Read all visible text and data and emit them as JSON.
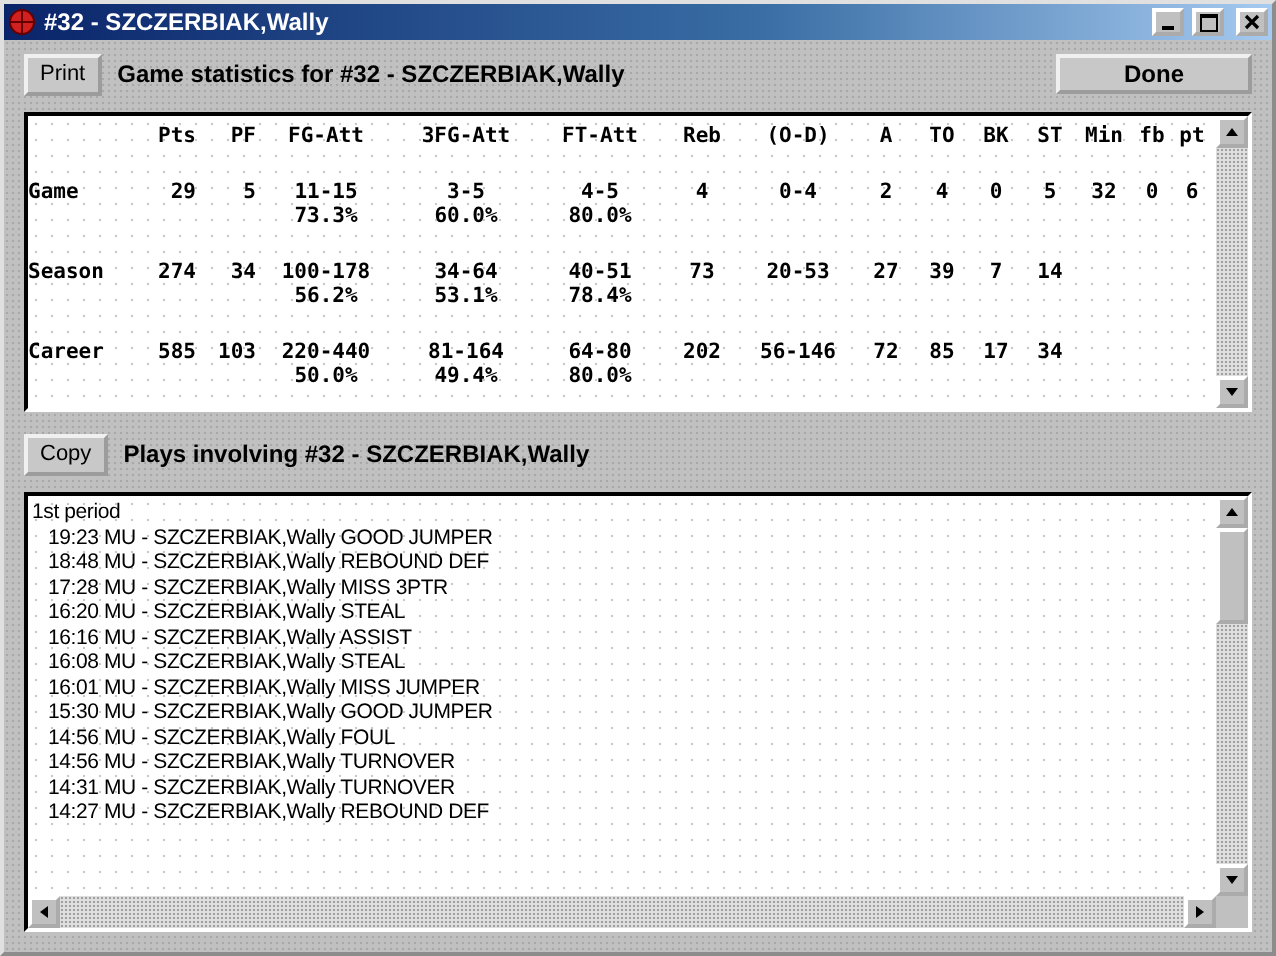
{
  "window": {
    "title": "#32 - SZCZERBIAK,Wally"
  },
  "stats_header": {
    "button": "Print",
    "title": "Game statistics for #32 - SZCZERBIAK,Wally",
    "done_button": "Done"
  },
  "stats": {
    "columns": [
      "Pts",
      "PF",
      "FG-Att",
      "3FG-Att",
      "FT-Att",
      "Reb",
      "(O-D)",
      "A",
      "TO",
      "BK",
      "ST",
      "Min",
      "fb",
      "pt"
    ],
    "rows": [
      {
        "label": "Game",
        "values": [
          "29",
          "5",
          "11-15",
          "3-5",
          "4-5",
          "4",
          "0-4",
          "2",
          "4",
          "0",
          "5",
          "32",
          "0",
          "6"
        ],
        "percents": [
          "73.3%",
          "60.0%",
          "80.0%"
        ]
      },
      {
        "label": "Season",
        "values": [
          "274",
          "34",
          "100-178",
          "34-64",
          "40-51",
          "73",
          "20-53",
          "27",
          "39",
          "7",
          "14"
        ],
        "percents": [
          "56.2%",
          "53.1%",
          "78.4%"
        ]
      },
      {
        "label": "Career",
        "values": [
          "585",
          "103",
          "220-440",
          "81-164",
          "64-80",
          "202",
          "56-146",
          "72",
          "85",
          "17",
          "34"
        ],
        "percents": [
          "50.0%",
          "49.4%",
          "80.0%"
        ]
      }
    ]
  },
  "plays_header": {
    "button": "Copy",
    "title": "Plays involving #32 - SZCZERBIAK,Wally"
  },
  "plays": [
    {
      "period": "1st period",
      "items": [
        "19:23 MU - SZCZERBIAK,Wally GOOD JUMPER",
        "18:48 MU - SZCZERBIAK,Wally REBOUND DEF",
        "17:28 MU - SZCZERBIAK,Wally MISS 3PTR",
        "16:20 MU - SZCZERBIAK,Wally STEAL",
        "16:16 MU - SZCZERBIAK,Wally ASSIST",
        "16:08 MU - SZCZERBIAK,Wally STEAL",
        "16:01 MU - SZCZERBIAK,Wally MISS JUMPER",
        "15:30 MU - SZCZERBIAK,Wally GOOD JUMPER",
        "14:56 MU - SZCZERBIAK,Wally FOUL",
        "14:56 MU - SZCZERBIAK,Wally TURNOVER",
        "14:31 MU - SZCZERBIAK,Wally TURNOVER",
        "14:27 MU - SZCZERBIAK,Wally REBOUND DEF"
      ]
    }
  ]
}
